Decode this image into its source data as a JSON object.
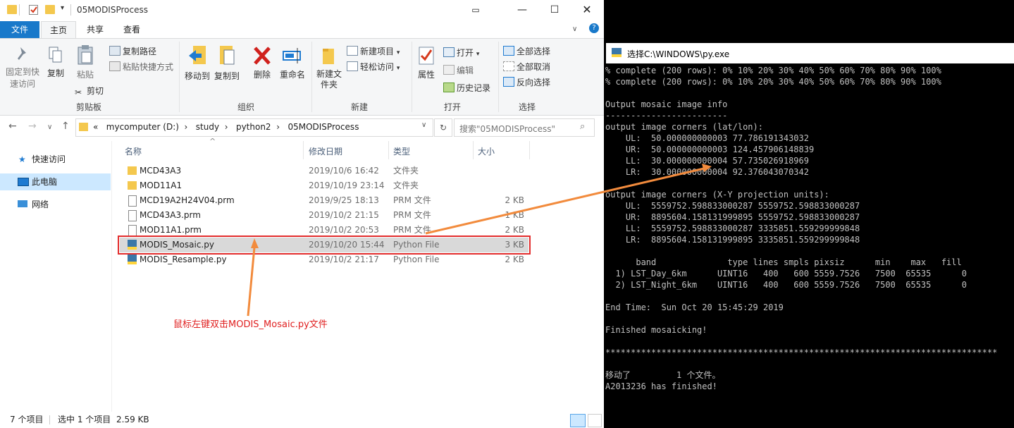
{
  "explorer": {
    "title": "05MODISProcess",
    "ribbon_tabs": [
      "文件",
      "主页",
      "共享",
      "查看"
    ],
    "clipboard": {
      "pin": "固定到快速访问",
      "copy": "复制",
      "paste": "粘贴",
      "copy_path": "复制路径",
      "paste_shortcut": "粘贴快捷方式",
      "cut": "剪切",
      "label": "剪贴板"
    },
    "organize": {
      "move_to": "移动到",
      "copy_to": "复制到",
      "delete": "删除",
      "rename": "重命名",
      "label": "组织"
    },
    "new": {
      "new_folder": "新建文件夹",
      "new_item": "新建项目",
      "easy_access": "轻松访问",
      "label": "新建"
    },
    "open": {
      "properties": "属性",
      "open": "打开",
      "edit": "编辑",
      "history": "历史记录",
      "label": "打开"
    },
    "select": {
      "select_all": "全部选择",
      "select_none": "全部取消",
      "invert": "反向选择",
      "label": "选择"
    },
    "address": [
      "«",
      "mycomputer (D:)",
      "study",
      "python2",
      "05MODISProcess"
    ],
    "search_placeholder": "搜索\"05MODISProcess\"",
    "nav": {
      "quick_access": "快速访问",
      "this_pc": "此电脑",
      "network": "网络"
    },
    "columns": [
      "名称",
      "修改日期",
      "类型",
      "大小"
    ],
    "files": [
      {
        "name": "MCD43A3",
        "date": "2019/10/6 16:42",
        "type": "文件夹",
        "size": ""
      },
      {
        "name": "MOD11A1",
        "date": "2019/10/19 23:14",
        "type": "文件夹",
        "size": ""
      },
      {
        "name": "MCD19A2H24V04.prm",
        "date": "2019/9/25 18:13",
        "type": "PRM 文件",
        "size": "2 KB"
      },
      {
        "name": "MCD43A3.prm",
        "date": "2019/10/2 21:15",
        "type": "PRM 文件",
        "size": "1 KB"
      },
      {
        "name": "MOD11A1.prm",
        "date": "2019/10/2 20:53",
        "type": "PRM 文件",
        "size": "2 KB"
      },
      {
        "name": "MODIS_Mosaic.py",
        "date": "2019/10/20 15:44",
        "type": "Python File",
        "size": "3 KB"
      },
      {
        "name": "MODIS_Resample.py",
        "date": "2019/10/2 21:17",
        "type": "Python File",
        "size": "2 KB"
      }
    ],
    "status": {
      "count": "7 个项目",
      "selected": "选中 1 个项目",
      "size": "2.59 KB"
    }
  },
  "annotation": "鼠标左键双击MODIS_Mosaic.py文件",
  "console": {
    "title": "选择C:\\WINDOWS\\py.exe",
    "lines": [
      "% complete (200 rows): 0% 10% 20% 30% 40% 50% 60% 70% 80% 90% 100%",
      "% complete (200 rows): 0% 10% 20% 30% 40% 50% 60% 70% 80% 90% 100%",
      "",
      "Output mosaic image info",
      "------------------------",
      "output image corners (lat/lon):",
      "    UL:  50.000000000003 77.786191343032",
      "    UR:  50.000000000003 124.457906148839",
      "    LL:  30.000000000004 57.735026918969",
      "    LR:  30.000000000004 92.376043070342",
      "",
      "output image corners (X-Y projection units):",
      "    UL:  5559752.598833000287 5559752.598833000287",
      "    UR:  8895604.158131999895 5559752.598833000287",
      "    LL:  5559752.598833000287 3335851.559299999848",
      "    LR:  8895604.158131999895 3335851.559299999848",
      "",
      "      band              type lines smpls pixsiz      min    max   fill",
      "  1) LST_Day_6km      UINT16   400   600 5559.7526   7500  65535      0",
      "  2) LST_Night_6km    UINT16   400   600 5559.7526   7500  65535      0",
      "",
      "End Time:  Sun Oct 20 15:45:29 2019",
      "",
      "Finished mosaicking!",
      "",
      "*****************************************************************************",
      "",
      "移动了         1 个文件。",
      "A2013236 has finished!"
    ]
  }
}
